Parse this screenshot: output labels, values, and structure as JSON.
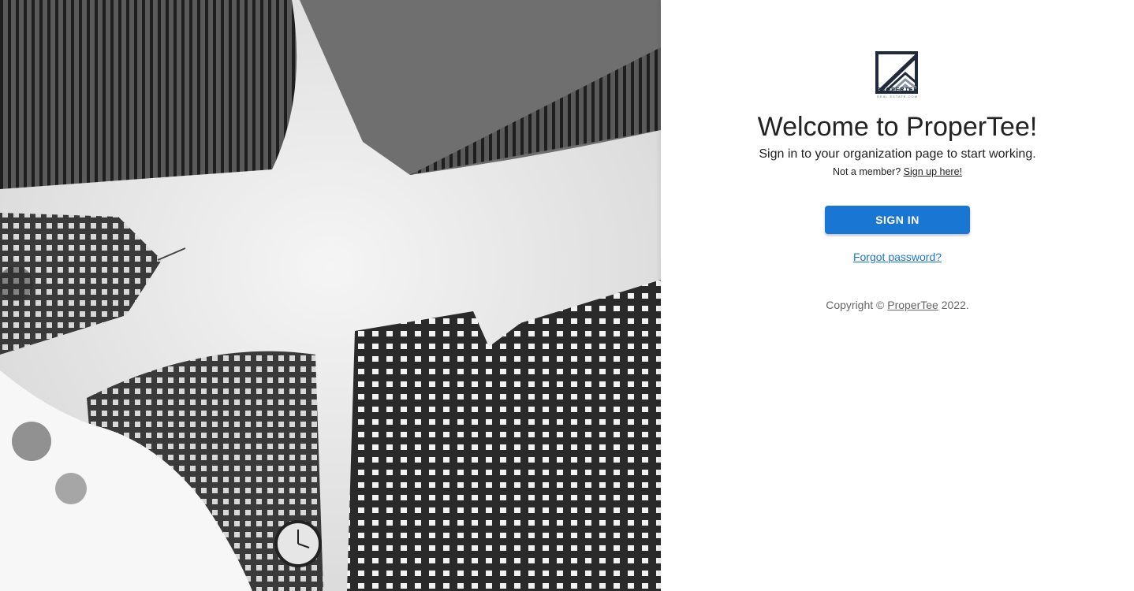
{
  "hero": {
    "image": "city-skyscrapers-black-white-photo"
  },
  "brand": {
    "name": "PROPERTEE",
    "tagline": "REAL ESTATE.COM",
    "logo_icon": "house-chevron-logo-icon"
  },
  "welcome": {
    "title": "Welcome to ProperTee!",
    "subtitle": "Sign in to your organization page to start working.",
    "member_prompt": "Not a member?",
    "signup_link": "Sign up here!"
  },
  "actions": {
    "sign_in": "SIGN IN",
    "forgot_password": "Forgot password?"
  },
  "footer": {
    "copyright_prefix": "Copyright ©",
    "copyright_link": "ProperTee",
    "copyright_suffix": "2022."
  },
  "colors": {
    "primary": "#1976d2",
    "text": "#222222",
    "muted": "#666666",
    "logo_dark": "#1f2a3c"
  }
}
